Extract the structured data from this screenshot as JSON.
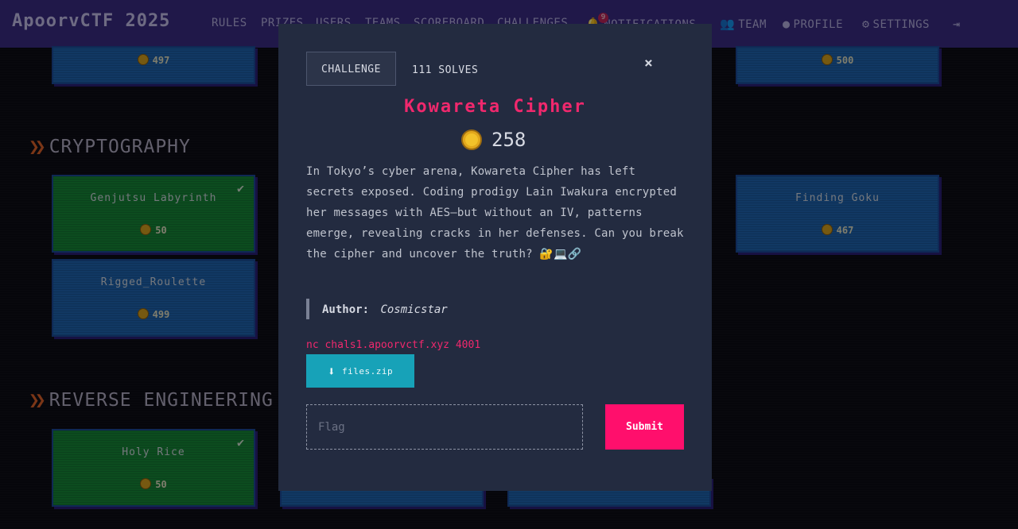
{
  "navbar": {
    "brand": "ApoorvCTF 2025",
    "links": {
      "rules": "RULES",
      "prizes": "PRIZES",
      "users": "USERS",
      "teams": "TEAMS",
      "scoreboard": "SCOREBOARD",
      "challenges": "CHALLENGES",
      "notifications": "NOTIFICATIONS",
      "team": "TEAM",
      "profile": "PROFILE",
      "settings": "SETTINGS"
    },
    "notification_count": "9",
    "icons": {
      "notifications": "bell-icon",
      "team": "users-icon",
      "profile": "user-circle-icon",
      "settings": "gears-icon",
      "logout": "sign-out-icon"
    }
  },
  "board": {
    "top_cards": [
      {
        "value": "497"
      },
      {
        "value": "500"
      }
    ],
    "sections": [
      {
        "title": "CRYPTOGRAPHY",
        "cards": [
          {
            "name": "Genjutsu Labyrinth",
            "value": "50",
            "solved": true
          },
          {
            "name": "Finding Goku",
            "value": "467",
            "solved": false
          },
          {
            "name": "Rigged_Roulette",
            "value": "499",
            "solved": false
          }
        ]
      },
      {
        "title": "REVERSE ENGINEERING",
        "cards": [
          {
            "name": "Holy Rice",
            "value": "50",
            "solved": true
          }
        ]
      }
    ]
  },
  "modal": {
    "tab_challenge": "CHALLENGE",
    "tab_solves": "111 SOLVES",
    "close_symbol": "×",
    "title": "Kowareta Cipher",
    "points": "258",
    "description": "In Tokyo’s cyber arena, Kowareta Cipher has left secrets exposed. Coding prodigy Lain Iwakura encrypted her messages with AES—but without an IV, patterns emerge, revealing cracks in her defenses. Can you break the cipher and uncover the truth? 🔐💻🔗",
    "author_label": "Author:",
    "author_name": "Cosmicstar",
    "connection": "nc chals1.apoorvctf.xyz 4001",
    "file_label": "files.zip",
    "flag_placeholder": "Flag",
    "flag_value": "",
    "submit_label": "Submit"
  },
  "colors": {
    "navbar": "#3b2d86",
    "accent_pink": "#f0286d",
    "submit": "#ff0f6c",
    "file_button": "#17a2b8",
    "card_blue": "#1f66b4",
    "card_green": "#178a3a",
    "modal_bg": "#232b40"
  }
}
